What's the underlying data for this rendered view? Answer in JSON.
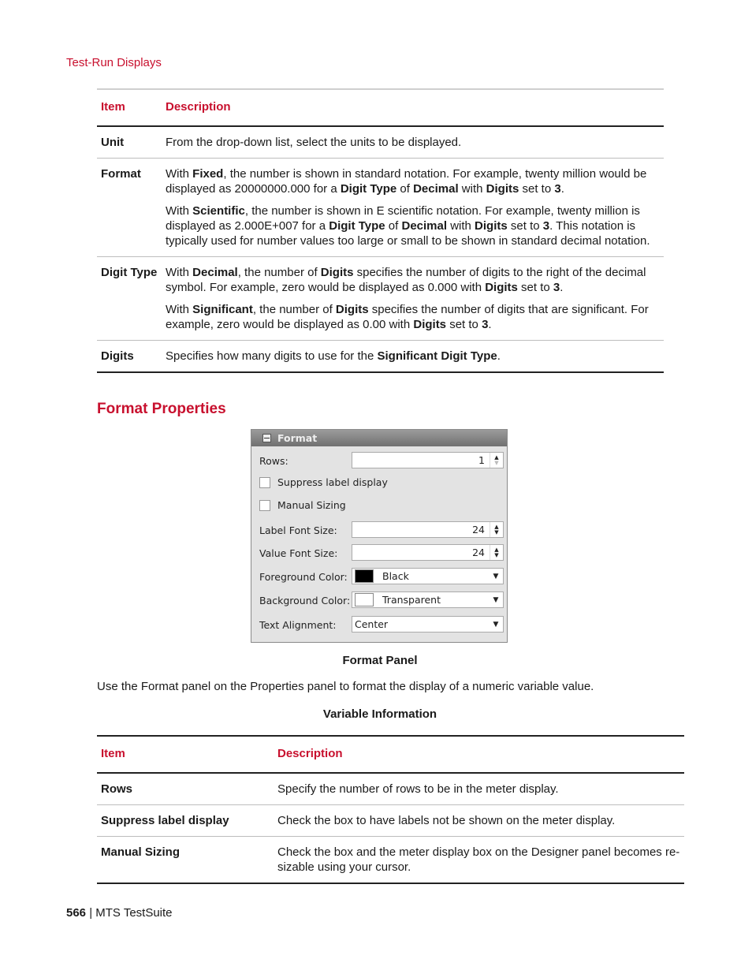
{
  "running_head": "Test-Run Displays",
  "table1": {
    "headers": [
      "Item",
      "Description"
    ],
    "rows": [
      {
        "item": "Unit",
        "paragraphs": [
          [
            {
              "t": "From the drop-down list, select the units to be displayed."
            }
          ]
        ]
      },
      {
        "item": "Format",
        "paragraphs": [
          [
            {
              "t": "With "
            },
            {
              "t": "Fixed",
              "b": true
            },
            {
              "t": ", the number is shown in standard notation. For example, twenty million would be displayed as 20000000.000 for a "
            },
            {
              "t": "Digit Type",
              "b": true
            },
            {
              "t": " of "
            },
            {
              "t": "Decimal",
              "b": true
            },
            {
              "t": " with "
            },
            {
              "t": "Digits",
              "b": true
            },
            {
              "t": " set to "
            },
            {
              "t": "3",
              "b": true
            },
            {
              "t": "."
            }
          ],
          [
            {
              "t": "With "
            },
            {
              "t": "Scientific",
              "b": true
            },
            {
              "t": ", the number is shown in E scientific notation. For example, twenty million is displayed as 2.000E+007 for a "
            },
            {
              "t": "Digit Type",
              "b": true
            },
            {
              "t": " of "
            },
            {
              "t": "Decimal",
              "b": true
            },
            {
              "t": " with "
            },
            {
              "t": "Digits",
              "b": true
            },
            {
              "t": " set to "
            },
            {
              "t": "3",
              "b": true
            },
            {
              "t": ". This notation is typically used for number values too large or small to be shown in standard decimal notation."
            }
          ]
        ]
      },
      {
        "item": "Digit Type",
        "paragraphs": [
          [
            {
              "t": "With "
            },
            {
              "t": "Decimal",
              "b": true
            },
            {
              "t": ", the number of "
            },
            {
              "t": "Digits",
              "b": true
            },
            {
              "t": " specifies the number of digits to the right of the decimal symbol. For example, zero would be displayed as 0.000 with "
            },
            {
              "t": "Digits",
              "b": true
            },
            {
              "t": " set to "
            },
            {
              "t": "3",
              "b": true
            },
            {
              "t": "."
            }
          ],
          [
            {
              "t": "With "
            },
            {
              "t": "Significant",
              "b": true
            },
            {
              "t": ", the number of "
            },
            {
              "t": "Digits",
              "b": true
            },
            {
              "t": " specifies the number of digits that are significant. For example, zero would be displayed as 0.00 with "
            },
            {
              "t": "Digits",
              "b": true
            },
            {
              "t": " set to "
            },
            {
              "t": "3",
              "b": true
            },
            {
              "t": "."
            }
          ]
        ]
      },
      {
        "item": "Digits",
        "paragraphs": [
          [
            {
              "t": "Specifies how many digits to use for the "
            },
            {
              "t": "Significant Digit Type",
              "b": true
            },
            {
              "t": "."
            }
          ]
        ]
      }
    ]
  },
  "section_title": "Format Properties",
  "panel": {
    "title": "Format",
    "rows_label": "Rows:",
    "rows_value": "1",
    "suppress_label": "Suppress label display",
    "suppress_checked": false,
    "manual_label": "Manual Sizing",
    "manual_checked": false,
    "label_font_label": "Label Font Size:",
    "label_font_value": "24",
    "value_font_label": "Value Font Size:",
    "value_font_value": "24",
    "fg_label": "Foreground Color:",
    "fg_value": "Black",
    "fg_color": "#000000",
    "bg_label": "Background Color:",
    "bg_value": "Transparent",
    "bg_color": "#ffffff",
    "align_label": "Text Alignment:",
    "align_value": "Center"
  },
  "figure_caption": "Format Panel",
  "body_text": "Use the Format panel on the Properties panel to format the display of a numeric variable value.",
  "table2_caption": "Variable Information",
  "table2": {
    "headers": [
      "Item",
      "Description"
    ],
    "rows": [
      {
        "item": "Rows",
        "desc": "Specify the number of rows to be in the meter display."
      },
      {
        "item": "Suppress label display",
        "desc": "Check the box to have labels not be shown on the meter display."
      },
      {
        "item": "Manual Sizing",
        "desc": "Check the box and the meter display box on the Designer panel becomes re-sizable using your cursor."
      }
    ]
  },
  "footer": {
    "page_number": "566",
    "separator": " | ",
    "title": "MTS TestSuite"
  }
}
